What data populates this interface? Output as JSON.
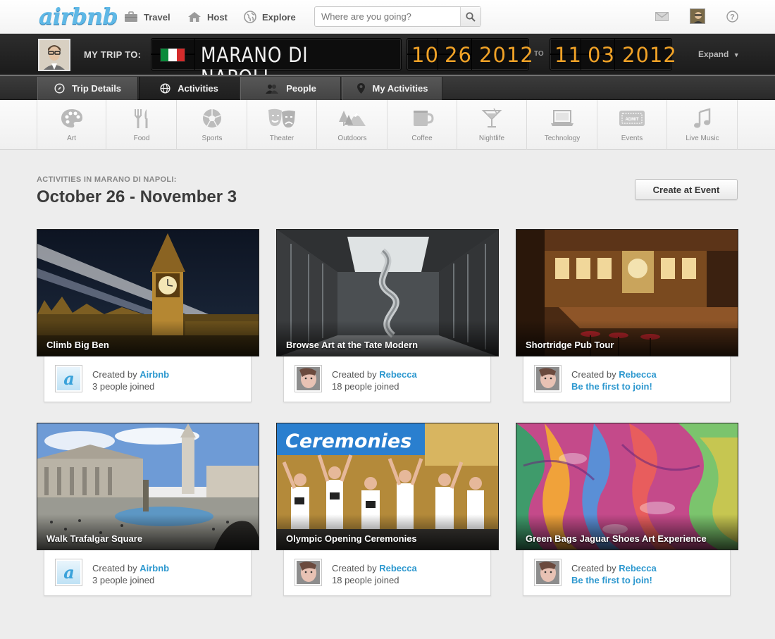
{
  "header": {
    "logo": "airbnb",
    "nav": [
      {
        "label": "Travel",
        "icon": "suitcase-icon"
      },
      {
        "label": "Host",
        "icon": "house-icon"
      },
      {
        "label": "Explore",
        "icon": "globe-icon"
      }
    ],
    "search_placeholder": "Where are you going?"
  },
  "trip": {
    "label": "MY TRIP TO:",
    "destination": "MARANO DI NAPOLI",
    "start": {
      "month": "10",
      "day": "26",
      "year": "2012"
    },
    "to_label": "TO",
    "end": {
      "month": "11",
      "day": "03",
      "year": "2012"
    },
    "expand": "Expand",
    "flag_colors": [
      "#0a8a3a",
      "#ffffff",
      "#d42b2b"
    ]
  },
  "tabs": [
    {
      "label": "Trip Details",
      "icon": "compass-icon"
    },
    {
      "label": "Activities",
      "icon": "globe-icon",
      "active": true
    },
    {
      "label": "People",
      "icon": "people-icon"
    },
    {
      "label": "My Activities",
      "icon": "pin-icon"
    }
  ],
  "categories": [
    {
      "label": "Art",
      "icon": "palette-icon"
    },
    {
      "label": "Food",
      "icon": "fork-knife-icon"
    },
    {
      "label": "Sports",
      "icon": "soccer-ball-icon"
    },
    {
      "label": "Theater",
      "icon": "masks-icon"
    },
    {
      "label": "Outdoors",
      "icon": "trees-mountain-icon"
    },
    {
      "label": "Coffee",
      "icon": "coffee-cup-icon"
    },
    {
      "label": "Nightlife",
      "icon": "cocktail-icon"
    },
    {
      "label": "Technology",
      "icon": "laptop-icon"
    },
    {
      "label": "Events",
      "icon": "ticket-icon"
    },
    {
      "label": "Live Music",
      "icon": "music-note-icon"
    }
  ],
  "main": {
    "subhead": "ACTIVITIES IN MARANO DI NAPOLI:",
    "title": "October 26 - November 3",
    "create_button": "Create at Event"
  },
  "activities": [
    {
      "title": "Climb Big Ben",
      "created_prefix": "Created by",
      "creator": "Airbnb",
      "joined": "3 people joined",
      "cta": false
    },
    {
      "title": "Browse Art at the Tate Modern",
      "created_prefix": "Created by",
      "creator": "Rebecca",
      "joined": "18 people joined",
      "cta": false
    },
    {
      "title": "Shortridge Pub Tour",
      "created_prefix": "Created by",
      "creator": "Rebecca",
      "joined": "Be the first to join!",
      "cta": true
    },
    {
      "title": "Walk Trafalgar Square",
      "created_prefix": "Created by",
      "creator": "Airbnb",
      "joined": "3 people joined",
      "cta": false
    },
    {
      "title": "Olympic Opening Ceremonies",
      "created_prefix": "Created by",
      "creator": "Rebecca",
      "joined": "18 people joined",
      "cta": false
    },
    {
      "title": "Green Bags Jaguar Shoes Art Experience",
      "created_prefix": "Created by",
      "creator": "Rebecca",
      "joined": "Be the first to join!",
      "cta": true
    }
  ]
}
